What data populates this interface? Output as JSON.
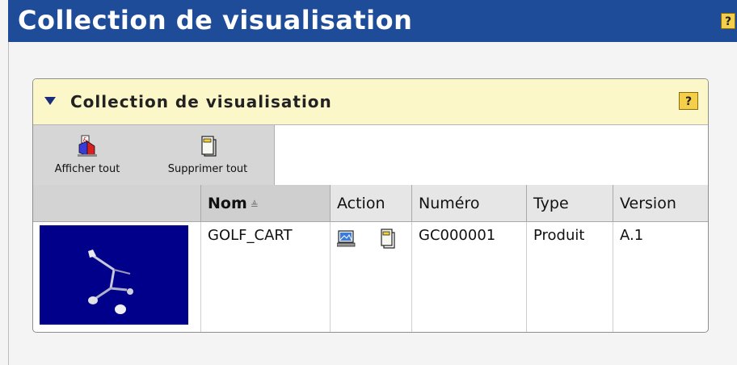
{
  "window": {
    "title": "Collection de visualisation",
    "help_label": "?"
  },
  "panel": {
    "title": "Collection de visualisation",
    "help_label": "?"
  },
  "toolbar": {
    "show_all_label": "Afficher tout",
    "remove_all_label": "Supprimer tout"
  },
  "table": {
    "columns": {
      "name": "Nom",
      "action": "Action",
      "number": "Numéro",
      "type": "Type",
      "version": "Version"
    },
    "sort_indicator": "≜",
    "rows": [
      {
        "name": "GOLF_CART",
        "number": "GC000001",
        "type": "Produit",
        "version": "A.1",
        "actions": [
          "view-icon",
          "remove-icon"
        ]
      }
    ]
  },
  "colors": {
    "title_bar": "#1f4c98",
    "panel_header": "#fcf7c9",
    "thumbnail_bg": "#00008a",
    "help_button": "#f6cf4a"
  }
}
